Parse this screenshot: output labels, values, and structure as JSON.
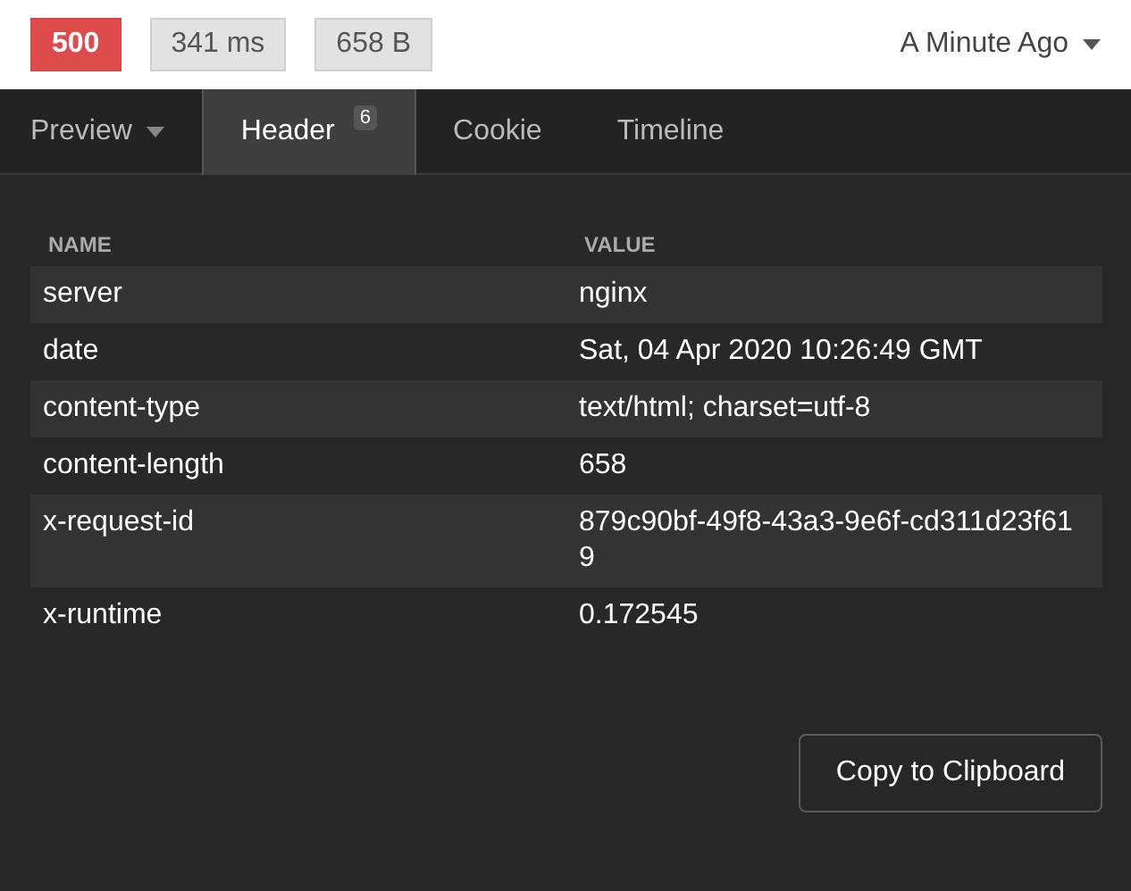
{
  "response_meta": {
    "status": "500",
    "time": "341 ms",
    "size": "658 B",
    "history": "A Minute Ago"
  },
  "tabs": [
    {
      "label": "Preview",
      "selected": false,
      "menu": true
    },
    {
      "label": "Header",
      "selected": true,
      "menu": false,
      "count": "6"
    },
    {
      "label": "Cookie",
      "selected": false,
      "menu": false
    },
    {
      "label": "Timeline",
      "selected": false,
      "menu": false
    }
  ],
  "table": {
    "columns": [
      "NAME",
      "VALUE"
    ],
    "rows": [
      [
        "server",
        "nginx"
      ],
      [
        "date",
        "Sat, 04 Apr 2020 10:26:49 GMT"
      ],
      [
        "content-type",
        "text/html; charset=utf-8"
      ],
      [
        "content-length",
        "658"
      ],
      [
        "x-request-id",
        "879c90bf-49f8-43a3-9e6f-cd311d23f619"
      ],
      [
        "x-runtime",
        "0.172545"
      ]
    ]
  },
  "buttons": [
    "Copy to Clipboard"
  ]
}
